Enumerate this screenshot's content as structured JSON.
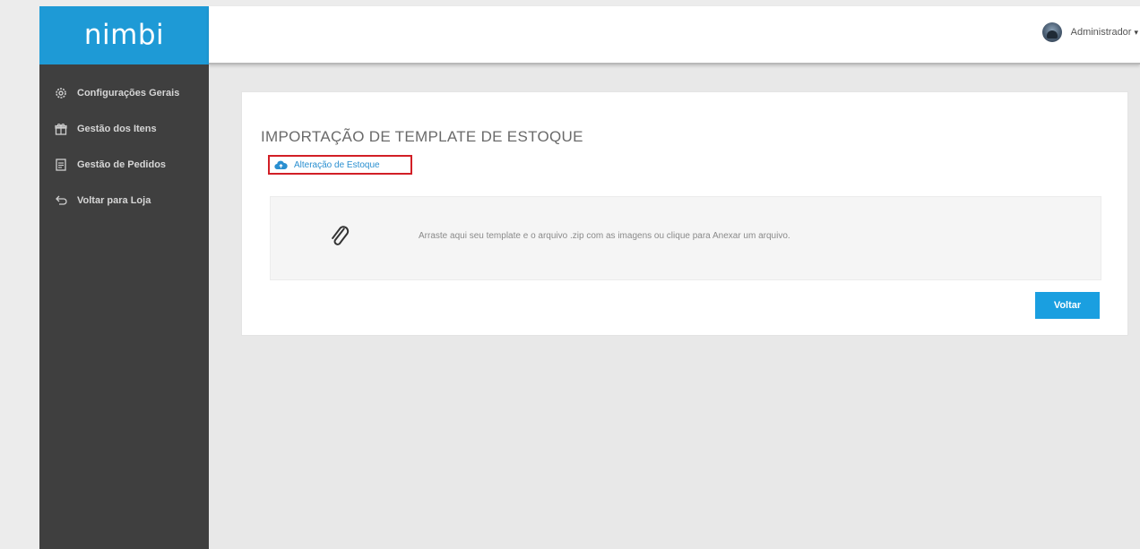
{
  "brand": {
    "logo_text": "nimbi",
    "color": "#1e9ad6"
  },
  "header": {
    "user_name": "Administrador",
    "caret": "▾"
  },
  "sidebar": {
    "items": [
      {
        "label": "Configurações Gerais",
        "icon": "gear-icon"
      },
      {
        "label": "Gestão dos Itens",
        "icon": "gift-icon"
      },
      {
        "label": "Gestão de Pedidos",
        "icon": "document-icon"
      },
      {
        "label": "Voltar para Loja",
        "icon": "return-icon"
      }
    ]
  },
  "main": {
    "title": "IMPORTAÇÃO DE TEMPLATE DE ESTOQUE",
    "upload_link": {
      "label": "Alteração de Estoque",
      "icon": "cloud-upload-icon"
    },
    "dropzone": {
      "text": "Arraste aqui seu template e o arquivo .zip com as imagens ou clique para Anexar um arquivo.",
      "icon": "paperclip-icon"
    },
    "back_button": "Voltar"
  },
  "colors": {
    "sidebar_bg": "#3f3f3f",
    "accent": "#1a9fe0",
    "highlight_border": "#d21f26"
  }
}
